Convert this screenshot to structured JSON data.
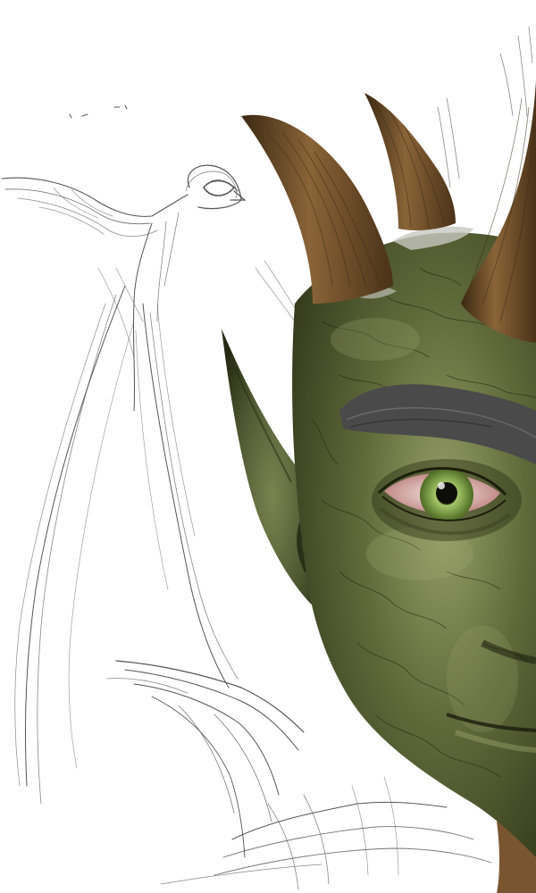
{
  "artwork": {
    "background_color": "#ffffff",
    "sketch_color": "#555555",
    "skin_color": "#5f6a3a",
    "skin_shadow_color": "#2f3418",
    "skin_highlight_color": "#98a068",
    "horn_color": "#6b4a26",
    "horn_tip_color": "#3a2812",
    "brow_color": "#4a4a4a",
    "iris_color": "#7fa04a",
    "subjects": [
      {
        "name": "bird-sketch-icon"
      },
      {
        "name": "goblin-face-icon"
      }
    ]
  }
}
